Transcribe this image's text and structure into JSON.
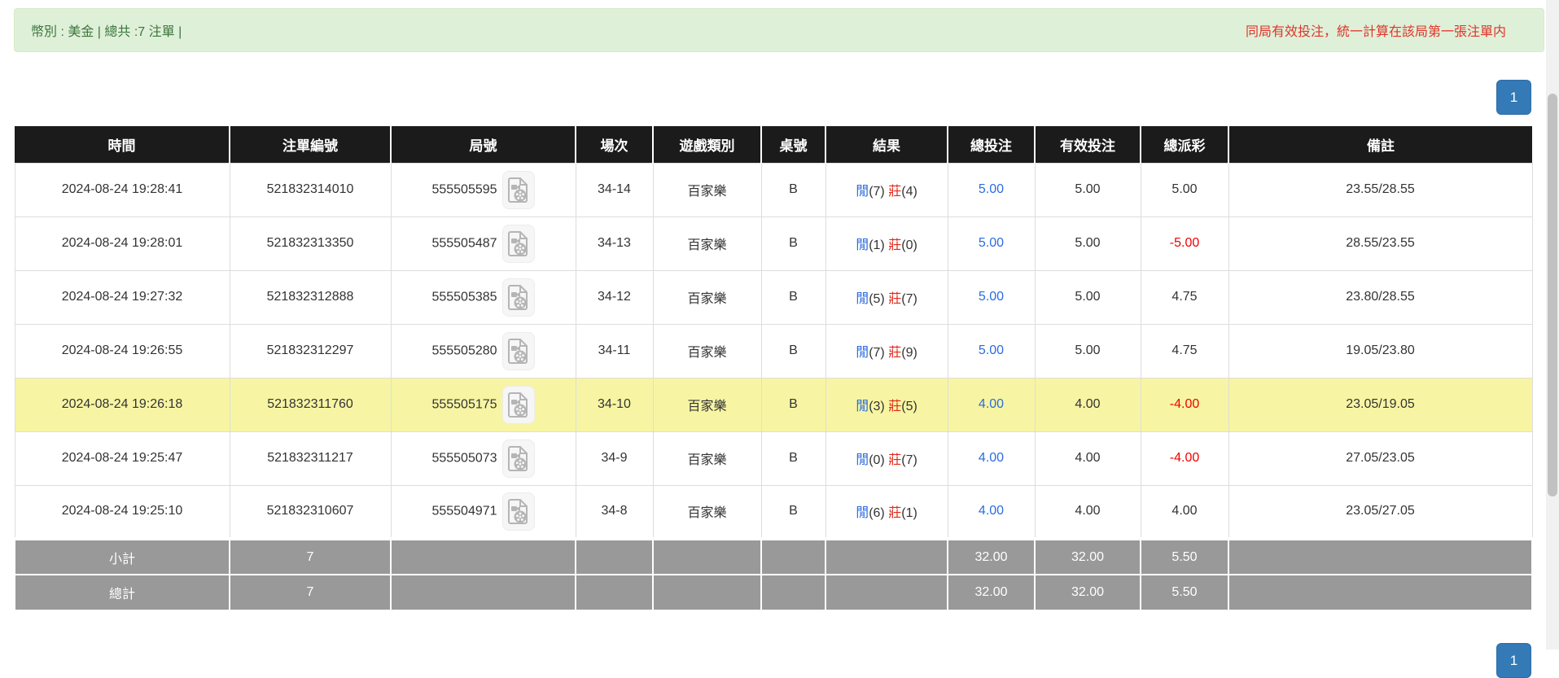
{
  "alert_bar": {
    "left_text": "幣別 : 美金 | 總共 :7 注單 |",
    "right_text": "同局有效投注，統一計算在該局第一張注單内"
  },
  "pagination": {
    "page": "1"
  },
  "table": {
    "columns": [
      "時間",
      "注單編號",
      "局號",
      "場次",
      "遊戲類別",
      "桌號",
      "結果",
      "總投注",
      "有效投注",
      "總派彩",
      "備註"
    ],
    "rows": [
      {
        "time": "2024-08-24 19:28:41",
        "bet_id": "521832314010",
        "round_id": "555505595",
        "session": "34-14",
        "game_type": "百家樂",
        "table_no": "B",
        "result_player_label": "閒",
        "result_player_score": "(7)",
        "result_banker_label": "莊",
        "result_banker_score": "(4)",
        "total_bet": "5.00",
        "valid_bet": "5.00",
        "payout": "5.00",
        "remark": "23.55/28.55",
        "highlighted": false
      },
      {
        "time": "2024-08-24 19:28:01",
        "bet_id": "521832313350",
        "round_id": "555505487",
        "session": "34-13",
        "game_type": "百家樂",
        "table_no": "B",
        "result_player_label": "閒",
        "result_player_score": "(1)",
        "result_banker_label": "莊",
        "result_banker_score": "(0)",
        "total_bet": "5.00",
        "valid_bet": "5.00",
        "payout": "-5.00",
        "remark": "28.55/23.55",
        "highlighted": false
      },
      {
        "time": "2024-08-24 19:27:32",
        "bet_id": "521832312888",
        "round_id": "555505385",
        "session": "34-12",
        "game_type": "百家樂",
        "table_no": "B",
        "result_player_label": "閒",
        "result_player_score": "(5)",
        "result_banker_label": "莊",
        "result_banker_score": "(7)",
        "total_bet": "5.00",
        "valid_bet": "5.00",
        "payout": "4.75",
        "remark": "23.80/28.55",
        "highlighted": false
      },
      {
        "time": "2024-08-24 19:26:55",
        "bet_id": "521832312297",
        "round_id": "555505280",
        "session": "34-11",
        "game_type": "百家樂",
        "table_no": "B",
        "result_player_label": "閒",
        "result_player_score": "(7)",
        "result_banker_label": "莊",
        "result_banker_score": "(9)",
        "total_bet": "5.00",
        "valid_bet": "5.00",
        "payout": "4.75",
        "remark": "19.05/23.80",
        "highlighted": false
      },
      {
        "time": "2024-08-24 19:26:18",
        "bet_id": "521832311760",
        "round_id": "555505175",
        "session": "34-10",
        "game_type": "百家樂",
        "table_no": "B",
        "result_player_label": "閒",
        "result_player_score": "(3)",
        "result_banker_label": "莊",
        "result_banker_score": "(5)",
        "total_bet": "4.00",
        "valid_bet": "4.00",
        "payout": "-4.00",
        "remark": "23.05/19.05",
        "highlighted": true
      },
      {
        "time": "2024-08-24 19:25:47",
        "bet_id": "521832311217",
        "round_id": "555505073",
        "session": "34-9",
        "game_type": "百家樂",
        "table_no": "B",
        "result_player_label": "閒",
        "result_player_score": "(0)",
        "result_banker_label": "莊",
        "result_banker_score": "(7)",
        "total_bet": "4.00",
        "valid_bet": "4.00",
        "payout": "-4.00",
        "remark": "27.05/23.05",
        "highlighted": false
      },
      {
        "time": "2024-08-24 19:25:10",
        "bet_id": "521832310607",
        "round_id": "555504971",
        "session": "34-8",
        "game_type": "百家樂",
        "table_no": "B",
        "result_player_label": "閒",
        "result_player_score": "(6)",
        "result_banker_label": "莊",
        "result_banker_score": "(1)",
        "total_bet": "4.00",
        "valid_bet": "4.00",
        "payout": "4.00",
        "remark": "23.05/27.05",
        "highlighted": false
      }
    ],
    "subtotal": {
      "label": "小計",
      "count": "7",
      "total_bet": "32.00",
      "valid_bet": "32.00",
      "payout": "5.50"
    },
    "total": {
      "label": "總計",
      "count": "7",
      "total_bet": "32.00",
      "valid_bet": "32.00",
      "payout": "5.50"
    }
  },
  "colors": {
    "accent_blue": "#337ab7",
    "player_blue": "#2b6ce0",
    "banker_red": "#e0291c",
    "amount_blue": "#2b6ce0",
    "negative_red": "#f20000",
    "highlight_yellow": "#f7f5a3",
    "header_bg": "#1b1b1b",
    "summary_bg": "#999999",
    "alert_bg": "#dff0d8",
    "alert_border": "#d6e9c6",
    "alert_text": "#3c763d",
    "notice_red": "#e03329",
    "border_gray": "#dddddd"
  }
}
